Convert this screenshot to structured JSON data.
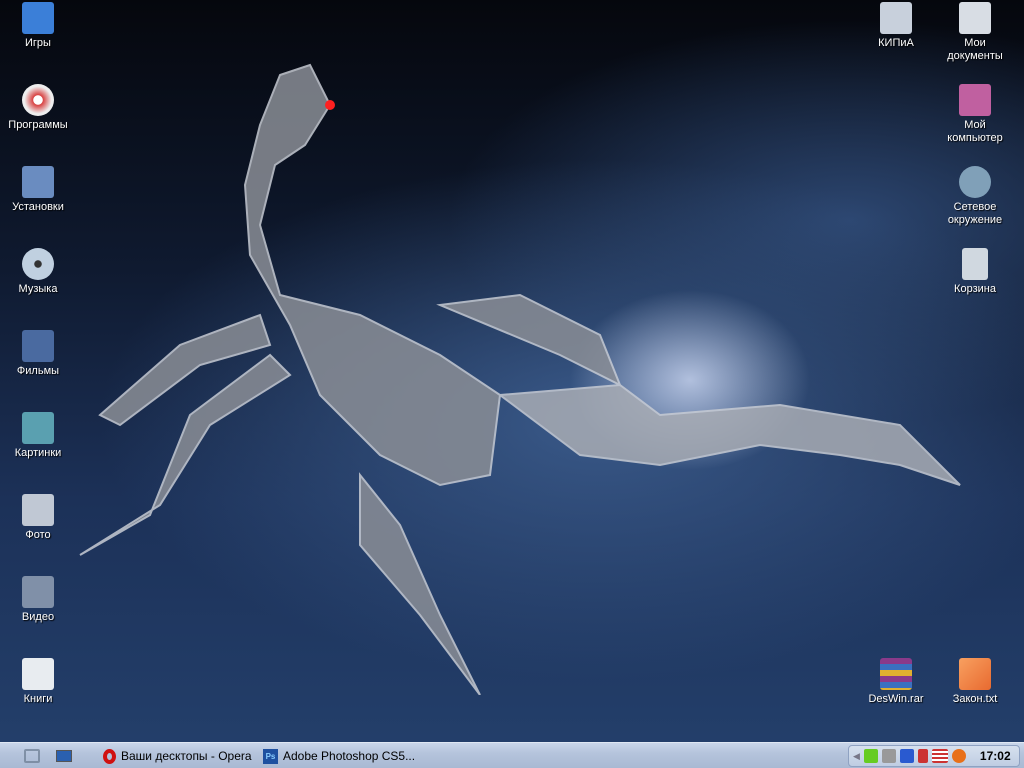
{
  "desktop_left": [
    {
      "label": "Игры",
      "icon": "monitor-games-icon",
      "color": "#3b7fd8"
    },
    {
      "label": "Программы",
      "icon": "cd-programs-icon",
      "color": "#d84040"
    },
    {
      "label": "Установки",
      "icon": "folder-installs-icon",
      "color": "#6a8cc0"
    },
    {
      "label": "Музыка",
      "icon": "music-disc-icon",
      "color": "#a0b8d0"
    },
    {
      "label": "Фильмы",
      "icon": "film-icon",
      "color": "#4a6aa0"
    },
    {
      "label": "Картинки",
      "icon": "pictures-icon",
      "color": "#5aa0b0"
    },
    {
      "label": "Фото",
      "icon": "camera-icon",
      "color": "#c0c8d4"
    },
    {
      "label": "Видео",
      "icon": "video-camera-icon",
      "color": "#8090a8"
    },
    {
      "label": "Книги",
      "icon": "document-icon",
      "color": "#e8ecf0"
    }
  ],
  "desktop_right": [
    {
      "label": "КИПиА",
      "icon": "folder-doc-icon",
      "color": "#c8d0dc"
    },
    {
      "label": "Мои документы",
      "icon": "my-documents-icon",
      "color": "#d8dde4"
    },
    {
      "label": "Мой компьютер",
      "icon": "my-computer-icon",
      "color": "#c060a0"
    },
    {
      "label": "Сетевое окружение",
      "icon": "network-icon",
      "color": "#80a0b8"
    },
    {
      "label": "Корзина",
      "icon": "recycle-bin-icon",
      "color": "#d0d8e0"
    }
  ],
  "desktop_files": [
    {
      "label": "DesWin.rar",
      "icon": "winrar-icon",
      "color": "#8a3a8a"
    },
    {
      "label": "Закон.txt",
      "icon": "text-file-icon",
      "color": "#e86a30"
    }
  ],
  "taskbar": {
    "tasks": [
      {
        "label": "Ваши десктопы - Opera",
        "icon": "opera-icon",
        "color": "#d01010"
      },
      {
        "label": "Adobe Photoshop CS5...",
        "icon": "photoshop-icon",
        "icon_text": "Ps",
        "color": "#1e50a0"
      }
    ],
    "clock": "17:02"
  }
}
